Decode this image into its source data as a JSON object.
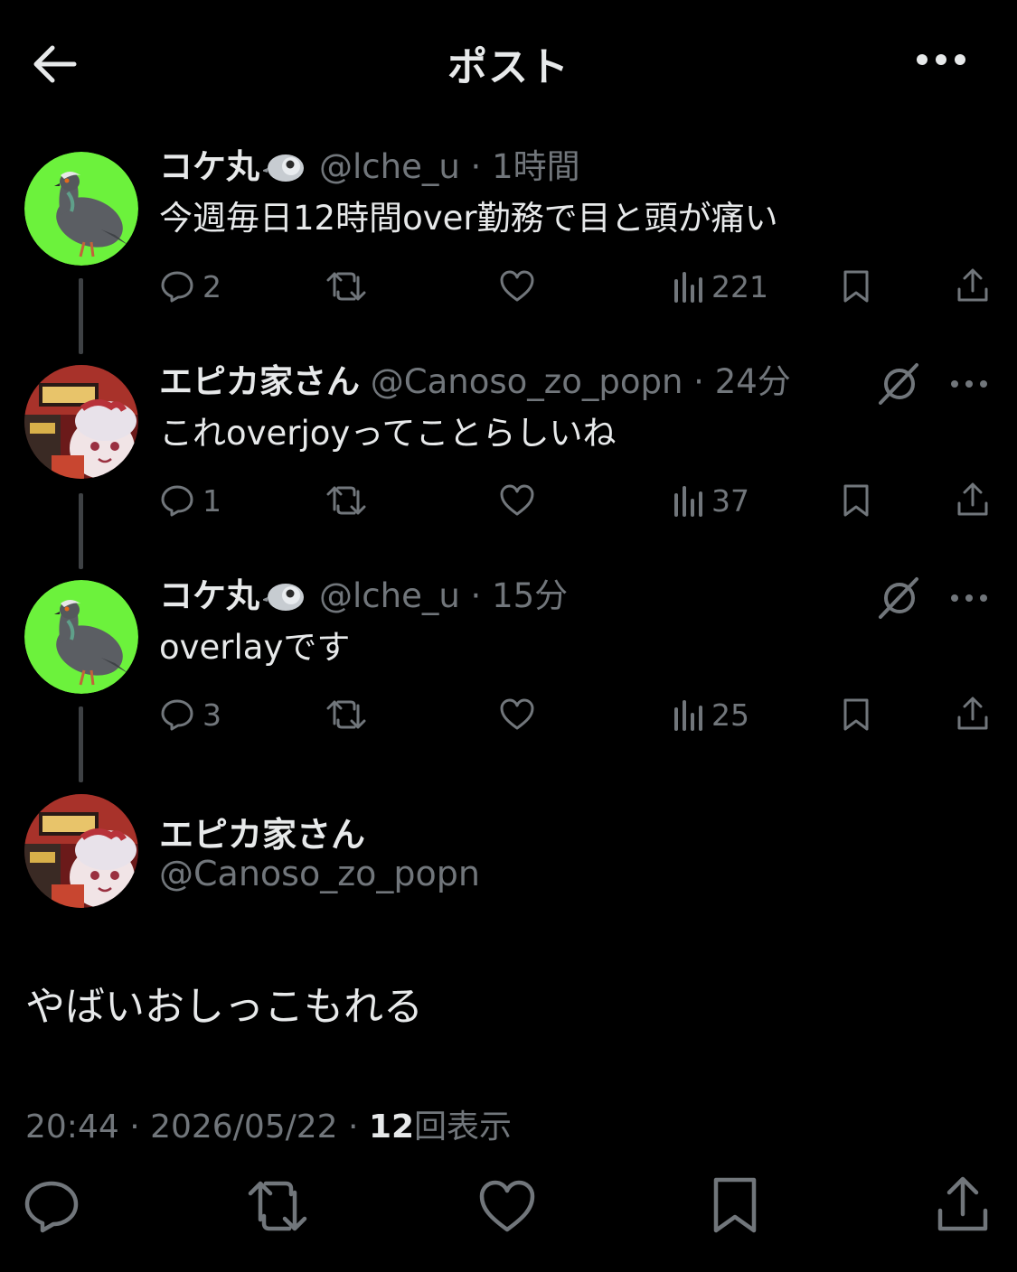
{
  "header": {
    "title": "ポスト"
  },
  "tweets": [
    {
      "name": "コケ丸",
      "handle": "@lche_u",
      "sep": " · ",
      "time": "1時間",
      "text": "今週毎日12時間over勤務で目と頭が痛い",
      "replies": "2",
      "views": "221"
    },
    {
      "name": "エピカ家さん",
      "handle": "@Canoso_zo_popn",
      "sep": " · ",
      "time": "24分",
      "text": "これoverjoyってことらしいね",
      "replies": "1",
      "views": "37"
    },
    {
      "name": "コケ丸",
      "handle": "@lche_u",
      "sep": " · ",
      "time": "15分",
      "text": "overlayです",
      "replies": "3",
      "views": "25"
    }
  ],
  "main_post": {
    "name": "エピカ家さん",
    "handle": "@Canoso_zo_popn",
    "text": "やばいおしっこもれる",
    "time": "20:44",
    "sep": " · ",
    "date": "2026/05/22",
    "sep2": " · ",
    "views_count": "12",
    "views_label": "回表示"
  },
  "icons": {
    "back": "arrow-left-icon",
    "more": "more-horizontal-icon",
    "reply": "reply-bubble-icon",
    "repost": "repost-icon",
    "like": "heart-icon",
    "views": "views-bar-chart-icon",
    "bookmark": "bookmark-icon",
    "share": "share-icon",
    "grok": "grok-icon"
  },
  "colors": {
    "background": "#000000",
    "text": "#e7e9ea",
    "secondary": "#71767b",
    "avatar_green": "#6cf23c",
    "thread_line": "#3e4144"
  }
}
